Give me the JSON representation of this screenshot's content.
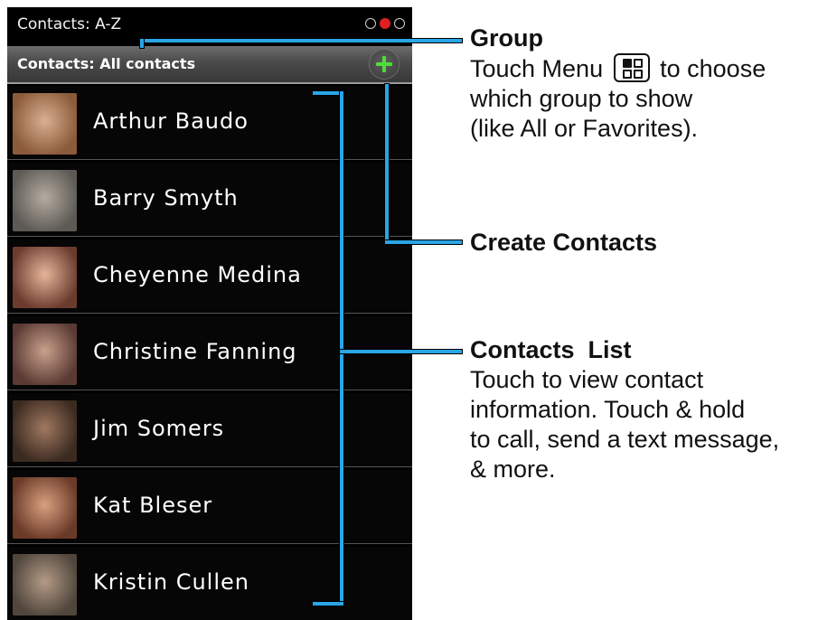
{
  "screen": {
    "title": "Contacts: A-Z",
    "page_indicator": {
      "count": 3,
      "active_index": 1
    },
    "group_bar": {
      "label": "Contacts: All contacts",
      "add_icon": "plus-icon"
    }
  },
  "contacts": [
    {
      "name": "Arthur Baudo",
      "avatar_colors": [
        "#8a5a3a",
        "#d9b090"
      ]
    },
    {
      "name": "Barry Smyth",
      "avatar_colors": [
        "#5d5a55",
        "#b4aca0"
      ]
    },
    {
      "name": "Cheyenne Medina",
      "avatar_colors": [
        "#6b3b2e",
        "#e6b59a"
      ]
    },
    {
      "name": "Christine Fanning",
      "avatar_colors": [
        "#5a3a33",
        "#c9a08c"
      ]
    },
    {
      "name": "Jim Somers",
      "avatar_colors": [
        "#3b2a20",
        "#a07860"
      ]
    },
    {
      "name": "Kat Bleser",
      "avatar_colors": [
        "#6a3a28",
        "#d9a080"
      ]
    },
    {
      "name": "Kristin Cullen",
      "avatar_colors": [
        "#50463c",
        "#b39a86"
      ]
    }
  ],
  "annotations": {
    "group": {
      "title": "Group",
      "line1_before": "Touch Menu",
      "menu_icon": "menu-key-icon",
      "line1_after": "to choose",
      "line2": "which group to show",
      "line3": "(like All or Favorites)."
    },
    "create": {
      "title": "Create Contacts"
    },
    "list": {
      "title": "Contacts  List",
      "line1": "Touch to view contact",
      "line2": "information. Touch & hold",
      "line3": "to call, send a text message,",
      "line4": "& more."
    }
  },
  "colors": {
    "callout_line": "#2aa5e6",
    "add_plus": "#4fdc3a",
    "active_dot": "#e02020"
  }
}
